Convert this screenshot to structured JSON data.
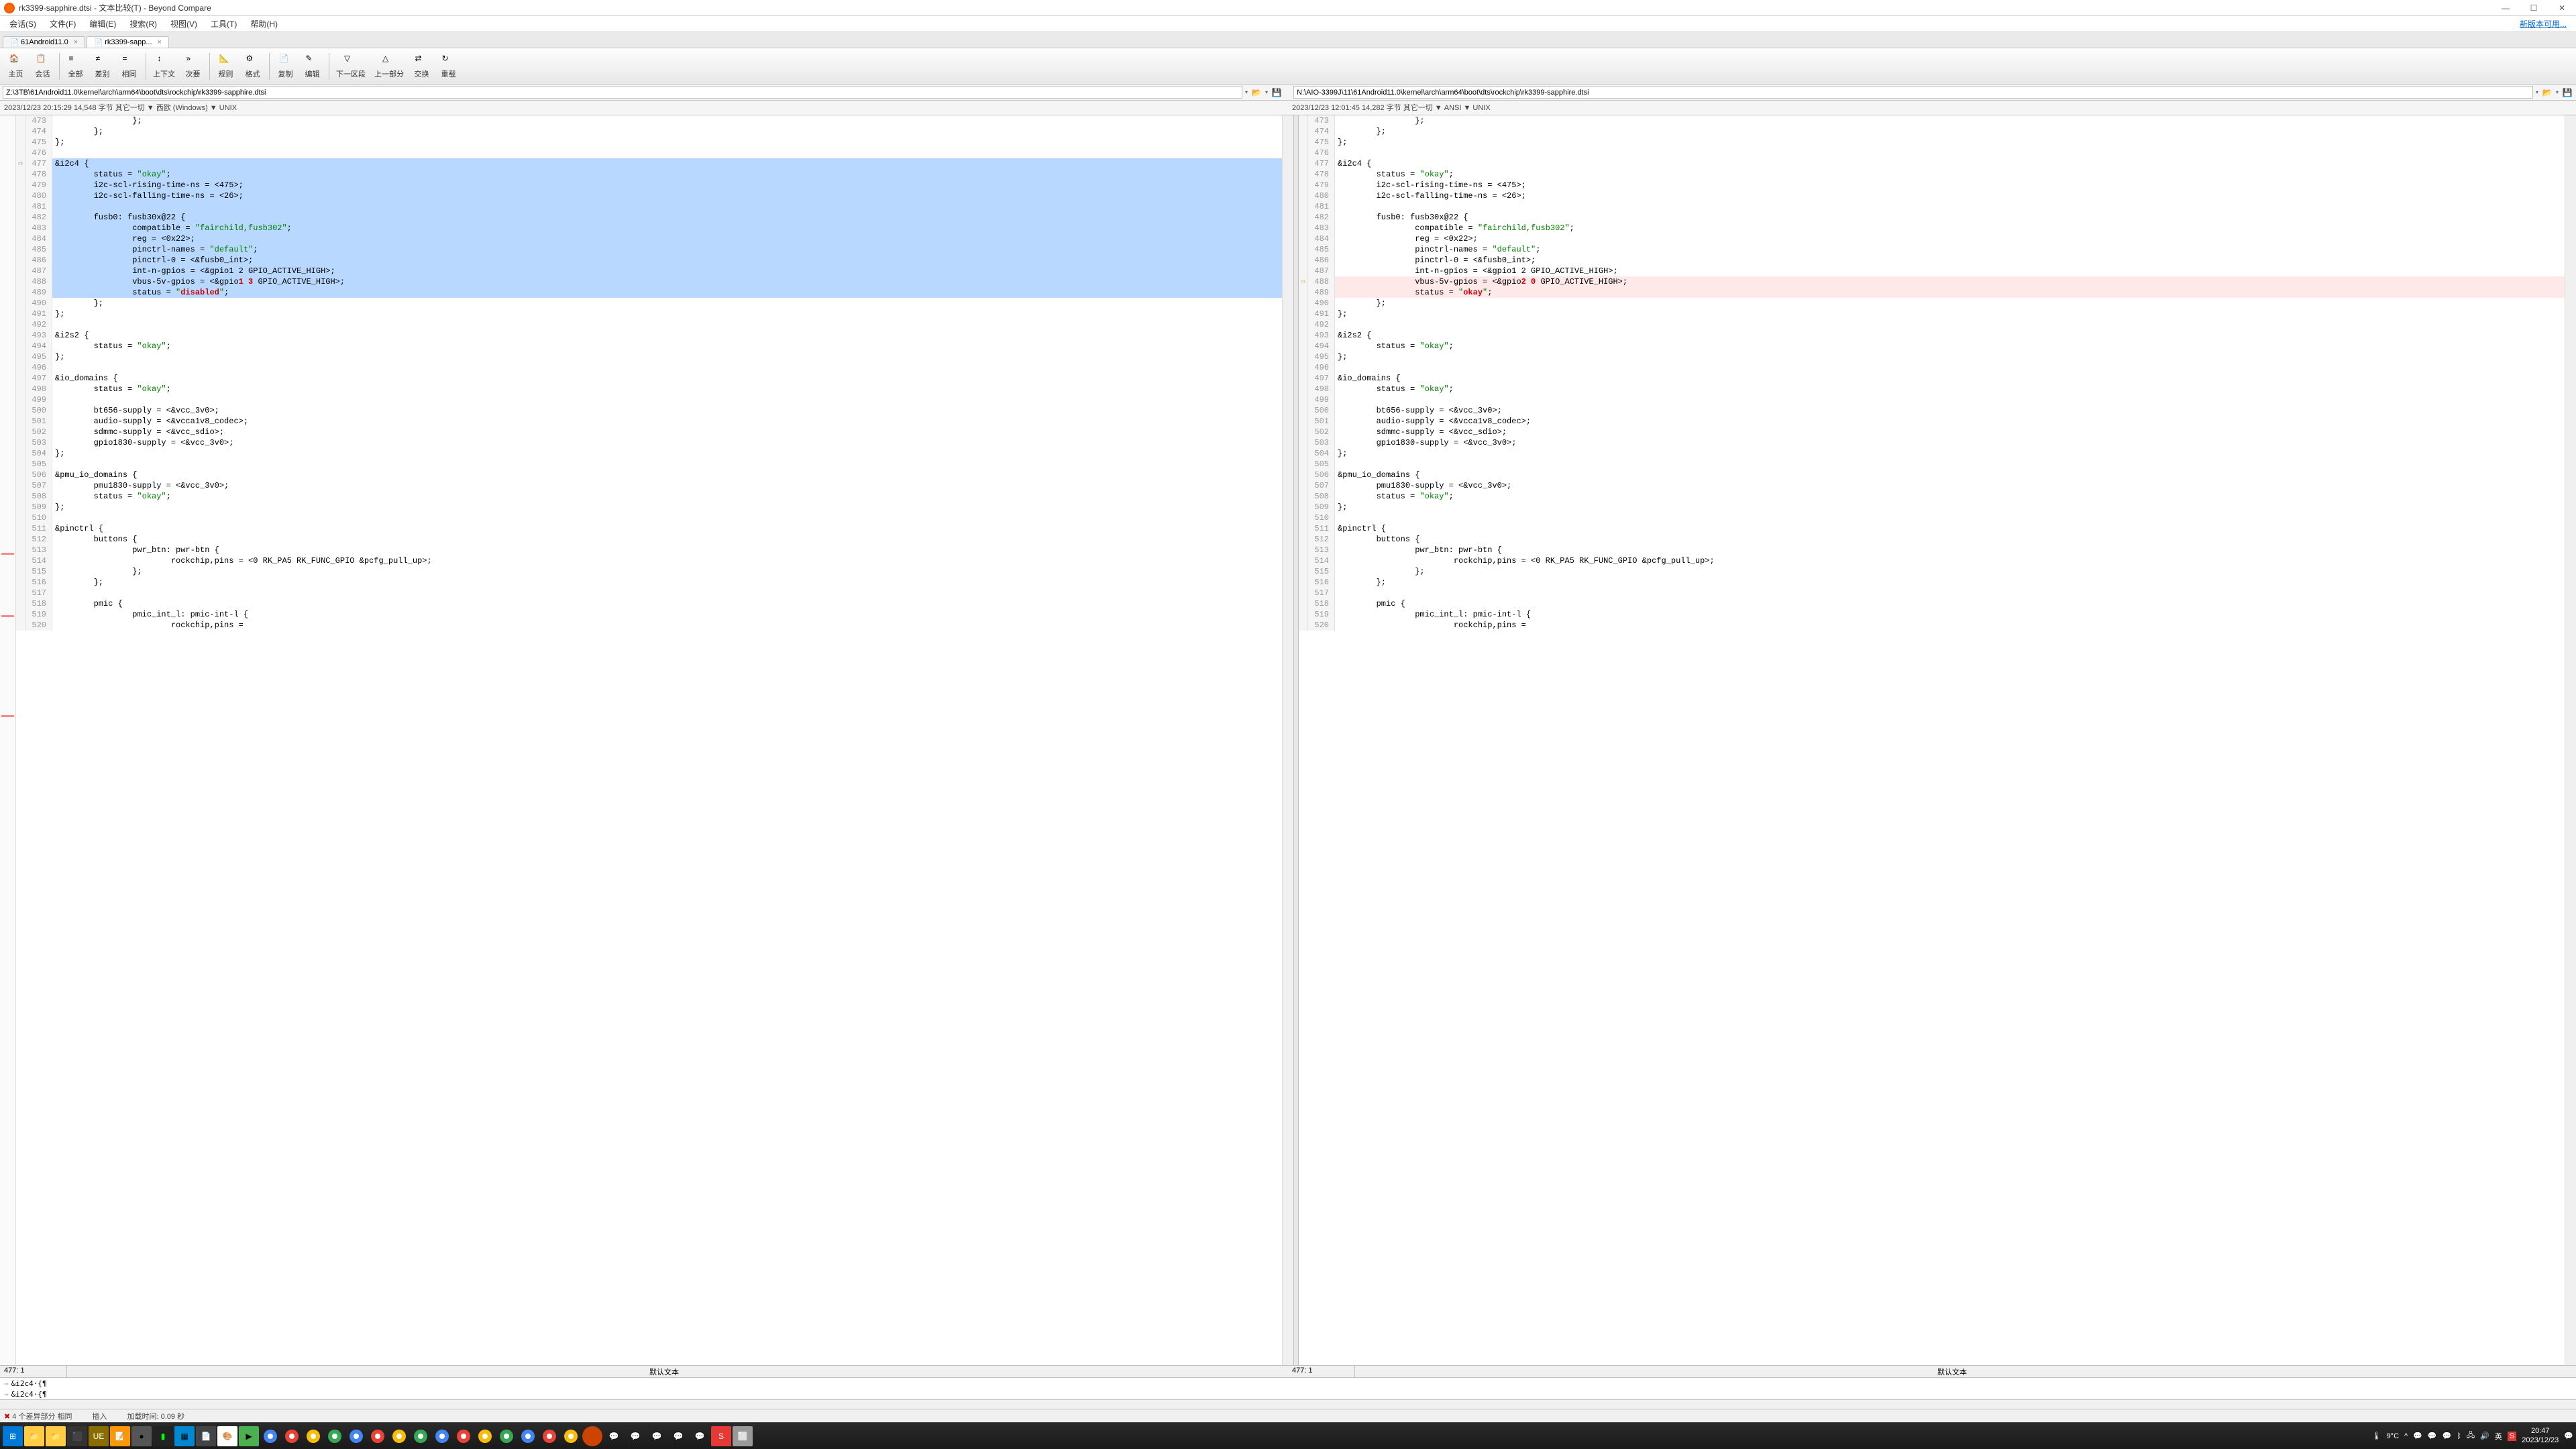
{
  "window": {
    "title": "rk3399-sapphire.dtsi - 文本比较(T) - Beyond Compare",
    "newVersion": "新版本可用..."
  },
  "menu": [
    "会话(S)",
    "文件(F)",
    "编辑(E)",
    "搜索(R)",
    "视图(V)",
    "工具(T)",
    "帮助(H)"
  ],
  "tabs": [
    {
      "label": "61Android11.0",
      "active": false
    },
    {
      "label": "rk3399-sapp...",
      "active": true
    }
  ],
  "toolbar": [
    {
      "label": "主页",
      "icon": "home"
    },
    {
      "label": "会话",
      "icon": "sessions"
    },
    {
      "sep": true
    },
    {
      "label": "全部",
      "icon": "all"
    },
    {
      "label": "差别",
      "icon": "diff"
    },
    {
      "label": "相同",
      "icon": "same"
    },
    {
      "sep": true
    },
    {
      "label": "上下文",
      "icon": "context"
    },
    {
      "label": "次要",
      "icon": "minor"
    },
    {
      "sep": true
    },
    {
      "label": "规则",
      "icon": "rules"
    },
    {
      "label": "格式",
      "icon": "format"
    },
    {
      "sep": true
    },
    {
      "label": "复制",
      "icon": "copy"
    },
    {
      "label": "编辑",
      "icon": "edit"
    },
    {
      "sep": true
    },
    {
      "label": "下一区段",
      "icon": "next"
    },
    {
      "label": "上一部分",
      "icon": "prev"
    },
    {
      "label": "交换",
      "icon": "swap"
    },
    {
      "label": "重载",
      "icon": "reload"
    }
  ],
  "left": {
    "path": "Z:\\3TB\\61Android11.0\\kernel\\arch\\arm64\\boot\\dts\\rockchip\\rk3399-sapphire.dtsi",
    "info": "2023/12/23 20:15:29   14,548 字节  其它一切 ▼  西欧 (Windows) ▼ UNIX",
    "pos": "477: 1",
    "ruler": "默认文本",
    "start": 473,
    "lines": [
      "                };",
      "        };",
      "};",
      "",
      "&i2c4 {",
      "        status = \"okay\";",
      "        i2c-scl-rising-time-ns = <475>;",
      "        i2c-scl-falling-time-ns = <26>;",
      "",
      "        fusb0: fusb30x@22 {",
      "                compatible = \"fairchild,fusb302\";",
      "                reg = <0x22>;",
      "                pinctrl-names = \"default\";",
      "                pinctrl-0 = <&fusb0_int>;",
      "                int-n-gpios = <&gpio1 2 GPIO_ACTIVE_HIGH>;",
      "                vbus-5v-gpios = <&gpio1 3 GPIO_ACTIVE_HIGH>;",
      "                status = \"disabled\";",
      "        };",
      "};",
      "",
      "&i2s2 {",
      "        status = \"okay\";",
      "};",
      "",
      "&io_domains {",
      "        status = \"okay\";",
      "",
      "        bt656-supply = <&vcc_3v0>;",
      "        audio-supply = <&vcca1v8_codec>;",
      "        sdmmc-supply = <&vcc_sdio>;",
      "        gpio1830-supply = <&vcc_3v0>;",
      "};",
      "",
      "&pmu_io_domains {",
      "        pmu1830-supply = <&vcc_3v0>;",
      "        status = \"okay\";",
      "};",
      "",
      "&pinctrl {",
      "        buttons {",
      "                pwr_btn: pwr-btn {",
      "                        rockchip,pins = <0 RK_PA5 RK_FUNC_GPIO &pcfg_pull_up>;",
      "                };",
      "        };",
      "",
      "        pmic {",
      "                pmic_int_l: pmic-int-l {",
      "                        rockchip,pins ="
    ],
    "selRange": [
      477,
      489
    ],
    "diffLines": [
      488,
      489
    ]
  },
  "right": {
    "path": "N:\\AIO-3399J\\11\\61Android11.0\\kernel\\arch\\arm64\\boot\\dts\\rockchip\\rk3399-sapphire.dtsi",
    "info": "2023/12/23 12:01:45   14,282 字节  其它一切 ▼  ANSI ▼ UNIX",
    "pos": "477: 1",
    "ruler": "默认文本",
    "start": 473,
    "lines": [
      "                };",
      "        };",
      "};",
      "",
      "&i2c4 {",
      "        status = \"okay\";",
      "        i2c-scl-rising-time-ns = <475>;",
      "        i2c-scl-falling-time-ns = <26>;",
      "",
      "        fusb0: fusb30x@22 {",
      "                compatible = \"fairchild,fusb302\";",
      "                reg = <0x22>;",
      "                pinctrl-names = \"default\";",
      "                pinctrl-0 = <&fusb0_int>;",
      "                int-n-gpios = <&gpio1 2 GPIO_ACTIVE_HIGH>;",
      "                vbus-5v-gpios = <&gpio2 0 GPIO_ACTIVE_HIGH>;",
      "                status = \"okay\";",
      "        };",
      "};",
      "",
      "&i2s2 {",
      "        status = \"okay\";",
      "};",
      "",
      "&io_domains {",
      "        status = \"okay\";",
      "",
      "        bt656-supply = <&vcc_3v0>;",
      "        audio-supply = <&vcca1v8_codec>;",
      "        sdmmc-supply = <&vcc_sdio>;",
      "        gpio1830-supply = <&vcc_3v0>;",
      "};",
      "",
      "&pmu_io_domains {",
      "        pmu1830-supply = <&vcc_3v0>;",
      "        status = \"okay\";",
      "};",
      "",
      "&pinctrl {",
      "        buttons {",
      "                pwr_btn: pwr-btn {",
      "                        rockchip,pins = <0 RK_PA5 RK_FUNC_GPIO &pcfg_pull_up>;",
      "                };",
      "        };",
      "",
      "        pmic {",
      "                pmic_int_l: pmic-int-l {",
      "                        rockchip,pins ="
    ],
    "diffLines": [
      488,
      489
    ]
  },
  "bottomDiff": [
    "&i2c4·{¶",
    "&i2c4·{¶"
  ],
  "status": {
    "diff": "4 个差异部分",
    "same": "相同",
    "mode": "插入",
    "load": "加载时间: 0.09 秒"
  },
  "taskbar": {
    "weather": "9°C",
    "ime": "英",
    "time": "20:47",
    "date": "2023/12/23"
  }
}
